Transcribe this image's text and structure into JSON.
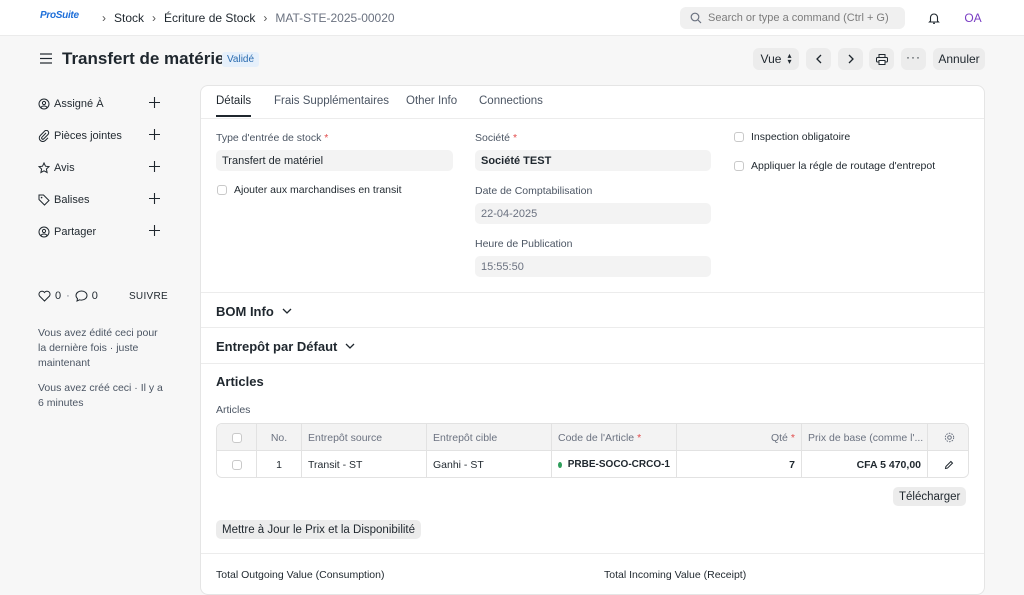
{
  "app": {
    "logo": "ProSuite"
  },
  "breadcrumbs": [
    "Stock",
    "Écriture de Stock",
    "MAT-STE-2025-00020"
  ],
  "search": {
    "placeholder": "Search or type a command (Ctrl + G)"
  },
  "user": {
    "initials": "OA"
  },
  "page": {
    "title": "Transfert de matériel",
    "status": "Validé",
    "view_label": "Vue",
    "cancel_label": "Annuler"
  },
  "sidebar": {
    "items": [
      {
        "label": "Assigné À",
        "icon": "user-add-icon"
      },
      {
        "label": "Pièces jointes",
        "icon": "paperclip-icon"
      },
      {
        "label": "Avis",
        "icon": "star-icon"
      },
      {
        "label": "Balises",
        "icon": "tag-icon"
      },
      {
        "label": "Partager",
        "icon": "share-user-icon"
      }
    ],
    "likes": "0",
    "comments": "0",
    "dot": "·",
    "follow": "SUIVRE",
    "activity": [
      "Vous avez édité ceci pour la dernière fois · juste maintenant",
      "Vous avez créé ceci · Il y a 6 minutes"
    ]
  },
  "tabs": [
    "Détails",
    "Frais Supplémentaires",
    "Other Info",
    "Connections"
  ],
  "form": {
    "entry_type_label": "Type d'entrée de stock",
    "entry_type_value": "Transfert de matériel",
    "transit_label": "Ajouter aux marchandises en transit",
    "company_label": "Société",
    "company_value": "Société TEST",
    "posting_date_label": "Date de Comptabilisation",
    "posting_date_value": "22-04-2025",
    "posting_time_label": "Heure de Publication",
    "posting_time_value": "15:55:50",
    "inspection_label": "Inspection obligatoire",
    "routing_label": "Appliquer la régle de routage d'entrepot",
    "required_mark": "*"
  },
  "sections": {
    "bom": "BOM Info",
    "warehouse": "Entrepôt par Défaut",
    "articles": "Articles",
    "articles_sub": "Articles"
  },
  "table": {
    "headers": [
      "No.",
      "Entrepôt source",
      "Entrepôt cible",
      "Code de l'Article",
      "Qté",
      "Prix de base (comme l'..."
    ],
    "rows": [
      {
        "no": "1",
        "source": "Transit - ST",
        "target": "Ganhi - ST",
        "code": "PRBE-SOCO-CRCO-1",
        "qty": "7",
        "rate": "CFA 5 470,00"
      }
    ]
  },
  "buttons": {
    "upload": "Télécharger",
    "update_price": "Mettre à Jour le Prix et la Disponibilité"
  },
  "totals": {
    "outgoing_label": "Total Outgoing Value (Consumption)",
    "incoming_label": "Total Incoming Value (Receipt)"
  },
  "colors": {
    "accent": "#2b6cb0",
    "badge_bg": "#e6f0fb",
    "status_dot": "#2f9e5b"
  }
}
